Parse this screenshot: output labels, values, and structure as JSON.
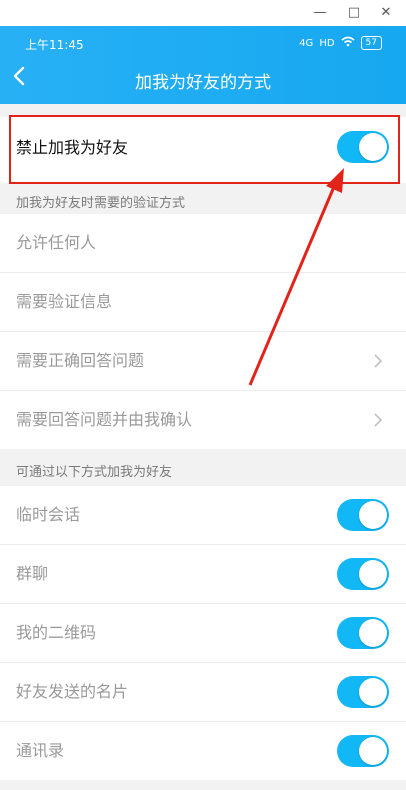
{
  "status_bar": {
    "time": "上午11:45",
    "signal1": "4G",
    "signal2": "HD",
    "battery": "57"
  },
  "window": {
    "minimize": "—",
    "maximize": "□",
    "close": "✕"
  },
  "header": {
    "title": "加我为好友的方式",
    "back_icon": "chevron-left-icon"
  },
  "forbid": {
    "label": "禁止加我为好友",
    "enabled": true
  },
  "verify_section": {
    "caption": "加我为好友时需要的验证方式",
    "items": [
      {
        "label": "允许任何人",
        "chevron": false
      },
      {
        "label": "需要验证信息",
        "chevron": false
      },
      {
        "label": "需要正确回答问题",
        "chevron": true
      },
      {
        "label": "需要回答问题并由我确认",
        "chevron": true
      }
    ]
  },
  "ways_section": {
    "caption": "可通过以下方式加我为好友",
    "items": [
      {
        "label": "临时会话",
        "enabled": true
      },
      {
        "label": "群聊",
        "enabled": true
      },
      {
        "label": "我的二维码",
        "enabled": true
      },
      {
        "label": "好友发送的名片",
        "enabled": true
      },
      {
        "label": "通讯录",
        "enabled": true
      }
    ]
  },
  "colors": {
    "header": "#1aa9f2",
    "toggle_on": "#12b7f5",
    "highlight": "#e2231a"
  }
}
